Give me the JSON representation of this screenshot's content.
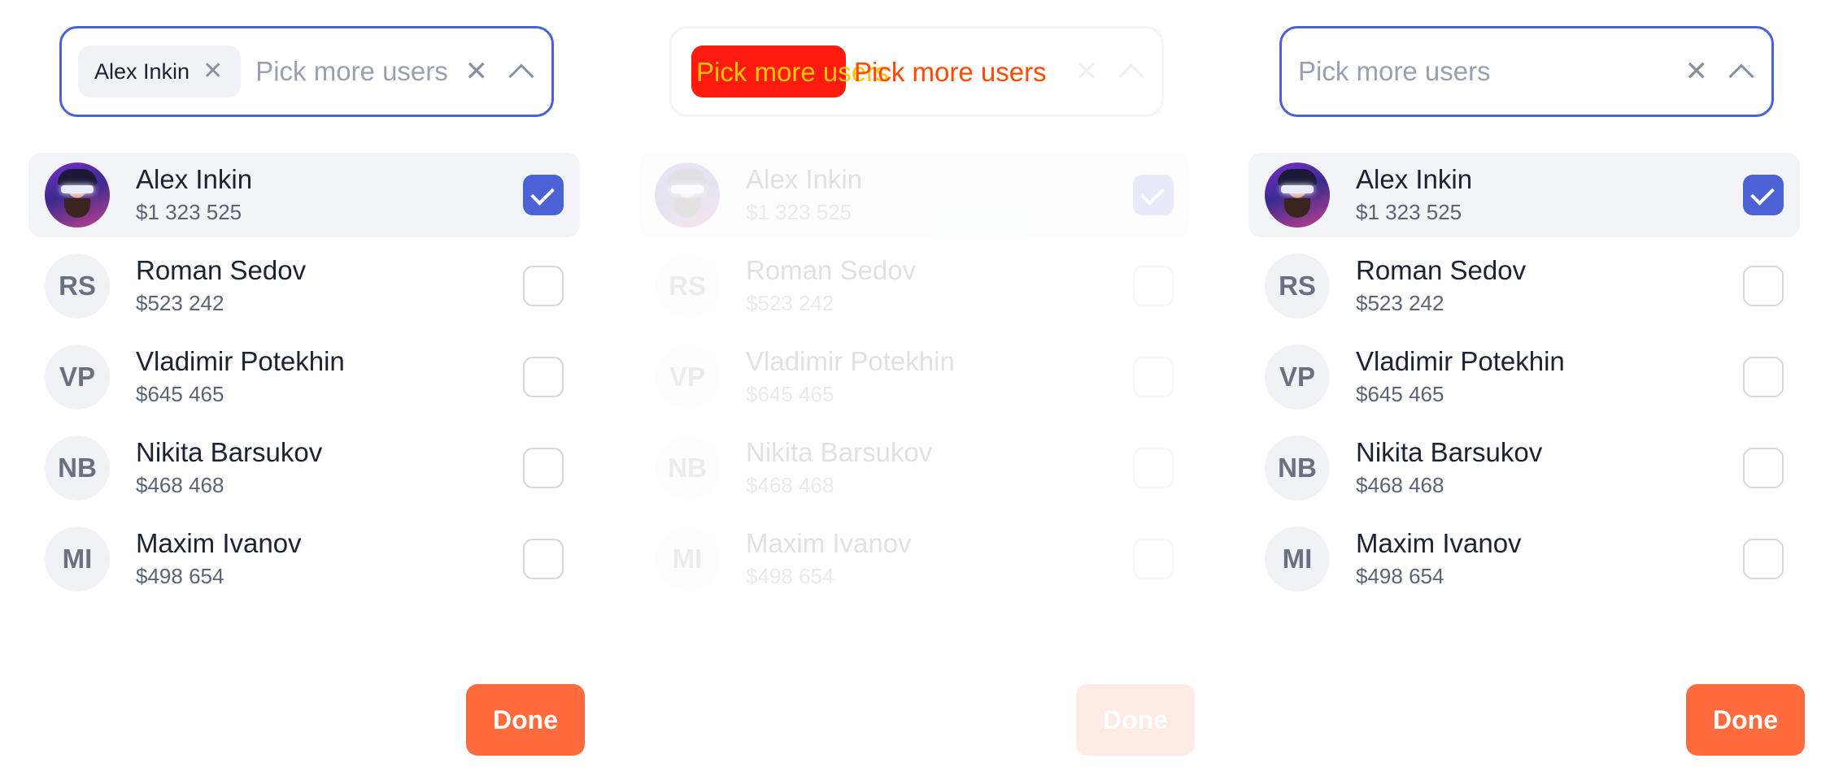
{
  "panels": [
    {
      "chip_label": "Alex Inkin",
      "placeholder": "Pick more users",
      "users": [
        {
          "name": "Alex Inkin",
          "amount": "$1 323 525",
          "initials": "",
          "checked": true
        },
        {
          "name": "Roman Sedov",
          "amount": "$523 242",
          "initials": "RS",
          "checked": false
        },
        {
          "name": "Vladimir Potekhin",
          "amount": "$645 465",
          "initials": "VP",
          "checked": false
        },
        {
          "name": "Nikita Barsukov",
          "amount": "$468 468",
          "initials": "NB",
          "checked": false
        },
        {
          "name": "Maxim Ivanov",
          "amount": "$498 654",
          "initials": "MI",
          "checked": false
        }
      ],
      "done_label": "Done"
    },
    {
      "placeholder": "Pick more users",
      "users": [
        {
          "name": "Alex Inkin",
          "amount": "$1 323 525",
          "initials": "",
          "checked": true
        },
        {
          "name": "Roman Sedov",
          "amount": "$523 242",
          "initials": "RS",
          "checked": false
        },
        {
          "name": "Vladimir Potekhin",
          "amount": "$645 465",
          "initials": "VP",
          "checked": false
        },
        {
          "name": "Nikita Barsukov",
          "amount": "$468 468",
          "initials": "NB",
          "checked": false
        },
        {
          "name": "Maxim Ivanov",
          "amount": "$498 654",
          "initials": "MI",
          "checked": false
        }
      ],
      "done_label": "Done"
    },
    {
      "placeholder": "Pick more users",
      "users": [
        {
          "name": "Alex Inkin",
          "amount": "$1 323 525",
          "initials": "",
          "checked": true
        },
        {
          "name": "Roman Sedov",
          "amount": "$523 242",
          "initials": "RS",
          "checked": false
        },
        {
          "name": "Vladimir Potekhin",
          "amount": "$645 465",
          "initials": "VP",
          "checked": false
        },
        {
          "name": "Nikita Barsukov",
          "amount": "$468 468",
          "initials": "NB",
          "checked": false
        },
        {
          "name": "Maxim Ivanov",
          "amount": "$498 654",
          "initials": "MI",
          "checked": false
        }
      ],
      "done_label": "Done"
    }
  ],
  "glitch": {
    "text_a": "Pick more users",
    "text_b": "Pick more users"
  },
  "icons": {
    "clear": "close-icon",
    "collapse": "chevron-up-icon",
    "check": "check-icon"
  },
  "colors": {
    "accent": "#4a62d6",
    "done": "#ff6b3d",
    "glitch_red": "#ff1a0f",
    "glitch_yellow": "#ffc400"
  }
}
